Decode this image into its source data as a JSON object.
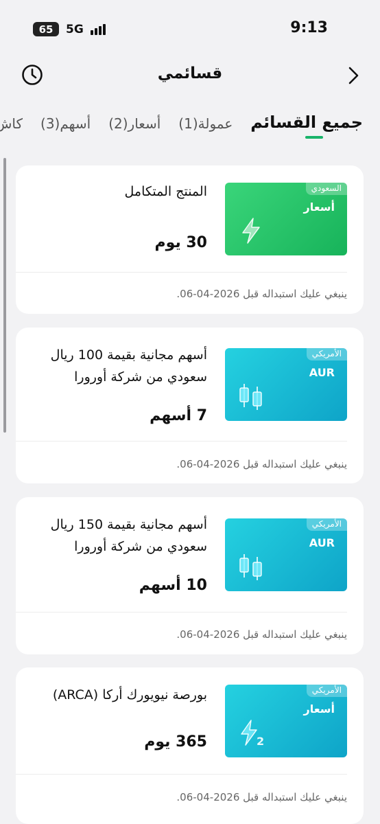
{
  "status_bar": {
    "battery": "65",
    "network": "5G",
    "time": "9:13"
  },
  "header": {
    "title": "قسائمي"
  },
  "tabs": [
    {
      "label": "جميع القسائم",
      "active": true
    },
    {
      "label": "عمولة(1)",
      "active": false
    },
    {
      "label": "أسعار(2)",
      "active": false
    },
    {
      "label": "أسهم(3)",
      "active": false
    },
    {
      "label": "كاش",
      "active": false
    }
  ],
  "accent_color": "#19b46a",
  "cards": [
    {
      "name": "المنتج المتكامل",
      "quantity": "30 يوم",
      "expiry": "ينبغي عليك استبداله قبل 2026-04-06.",
      "thumb": {
        "badge": "السعودي",
        "label": "أسعار",
        "icon": "lightning-icon",
        "color": "#2ecc71"
      }
    },
    {
      "name": "أسهم مجانية بقيمة 100 ريال سعودي من شركة أورورا",
      "quantity": "7 أسهم",
      "expiry": "ينبغي عليك استبداله قبل 2026-04-06.",
      "thumb": {
        "badge": "الأمريكي",
        "label": "AUR",
        "icon": "candlestick-icon",
        "color": "#1ab8d6"
      }
    },
    {
      "name": "أسهم مجانية بقيمة 150 ريال سعودي من شركة أورورا",
      "quantity": "10 أسهم",
      "expiry": "ينبغي عليك استبداله قبل 2026-04-06.",
      "thumb": {
        "badge": "الأمريكي",
        "label": "AUR",
        "icon": "candlestick-icon",
        "color": "#1ab8d6"
      }
    },
    {
      "name": "بورصة نيويورك أركا (ARCA)",
      "quantity": "365 يوم",
      "expiry": "ينبغي عليك استبداله قبل 2026-04-06.",
      "thumb": {
        "badge": "الأمريكي",
        "label": "أسعار",
        "icon": "lightning-2-icon",
        "color": "#1ab8d6"
      }
    }
  ]
}
